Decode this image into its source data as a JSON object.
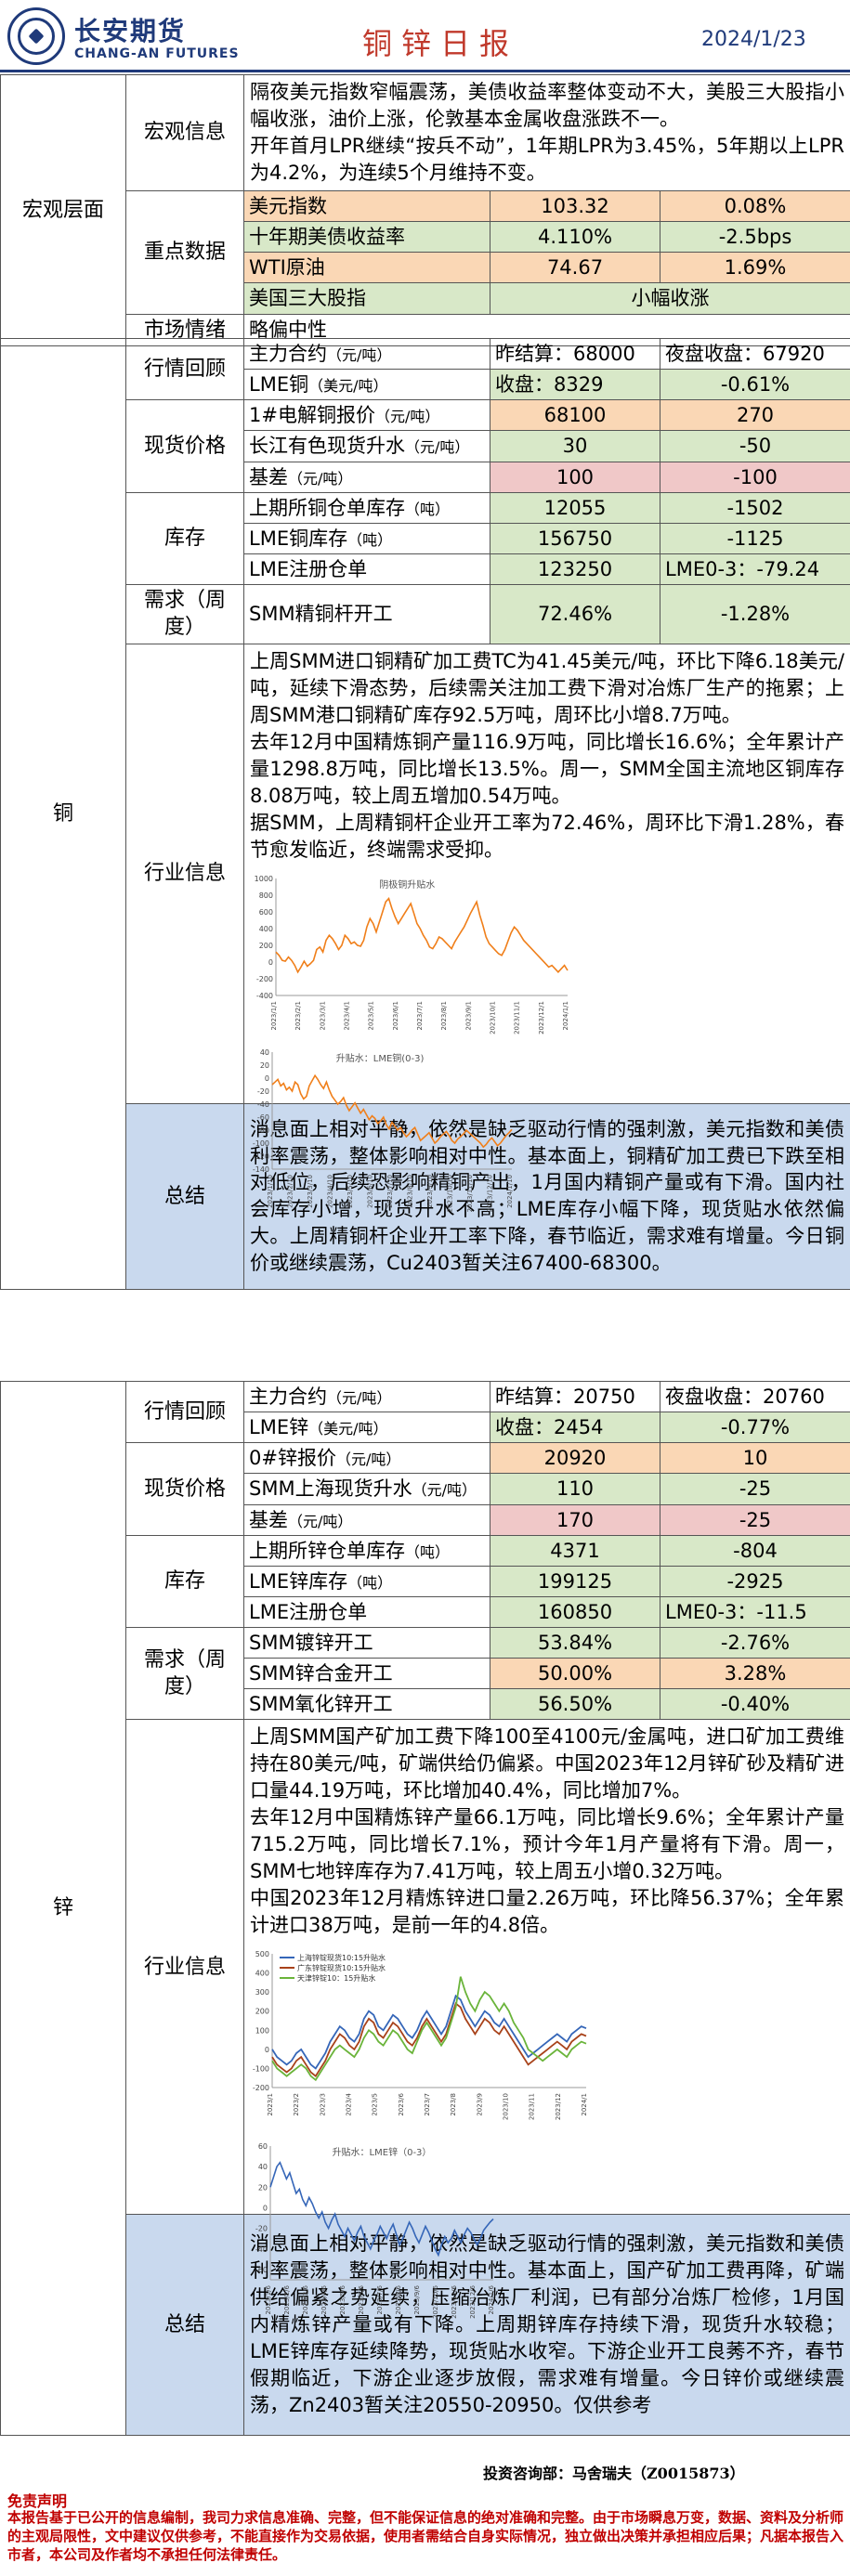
{
  "header": {
    "company_cn": "长安期货",
    "company_en": "CHANG-AN FUTURES",
    "title": "铜锌日报",
    "date": "2024/1/23"
  },
  "macro": {
    "section": "宏观层面",
    "info_label": "宏观信息",
    "info_text": "隔夜美元指数窄幅震荡，美债收益率整体变动不大，美股三大股指小幅收涨，油价上涨，伦敦基本金属收盘涨跌不一。\n开年首月LPR继续“按兵不动”，1年期LPR为3.45%，5年期以上LPR为4.2%，为连续5个月维持不变。",
    "data_label": "重点数据",
    "rows": [
      {
        "name": "美元指数",
        "val": "103.32",
        "chg": "0.08%"
      },
      {
        "name": "十年期美债收益率",
        "val": "4.110%",
        "chg": "-2.5bps"
      },
      {
        "name": "WTI原油",
        "val": "74.67",
        "chg": "1.69%"
      },
      {
        "name": "美国三大股指",
        "val": "小幅收涨"
      }
    ],
    "sentiment_label": "市场情绪",
    "sentiment": "略偏中性"
  },
  "copper": {
    "section": "铜",
    "review_label": "行情回顾",
    "main_contract": "主力合约",
    "main_unit": "（元/吨）",
    "prev_settle": "昨结算：68000",
    "night_close": "夜盘收盘：67920",
    "lme_name": "LME铜",
    "lme_unit": "（美元/吨）",
    "lme_close": "收盘：8329",
    "lme_chg": "-0.61%",
    "spot_label": "现货价格",
    "spot_rows": [
      {
        "name": "1#电解铜报价",
        "unit": "（元/吨）",
        "val": "68100",
        "chg": "270"
      },
      {
        "name": "长江有色现货升水",
        "unit": "（元/吨）",
        "val": "30",
        "chg": "-50"
      },
      {
        "name": "基差",
        "unit": "（元/吨）",
        "val": "100",
        "chg": "-100"
      }
    ],
    "stock_label": "库存",
    "stock_rows": [
      {
        "name": "上期所铜仓单库存",
        "unit": "（吨）",
        "val": "12055",
        "chg": "-1502"
      },
      {
        "name": "LME铜库存",
        "unit": "（吨）",
        "val": "156750",
        "chg": "-1125"
      },
      {
        "name": "LME注册仓单",
        "unit": "",
        "val": "123250",
        "chg": "LME0-3：-79.24"
      }
    ],
    "demand_label": "需求（周度）",
    "demand_rows": [
      {
        "name": "SMM精铜杆开工",
        "val": "72.46%",
        "chg": "-1.28%"
      }
    ],
    "industry_label": "行业信息",
    "industry_text": "上周SMM进口铜精矿加工费TC为41.45美元/吨，环比下降6.18美元/吨，延续下滑态势，后续需关注加工费下滑对冶炼厂生产的拖累；上周SMM港口铜精矿库存92.5万吨，周环比小增8.7万吨。\n去年12月中国精炼铜产量116.9万吨，同比增长16.6%；全年累计产量1298.8万吨，同比增长13.5%。周一，SMM全国主流地区铜库存8.08万吨，较上周五增加0.54万吨。\n据SMM，上周精铜杆企业开工率为72.46%，周环比下滑1.28%，春节愈发临近，终端需求受抑。",
    "summary_label": "总结",
    "summary_text": "消息面上相对平静，依然是缺乏驱动行情的强刺激，美元指数和美债利率震荡，整体影响相对中性。基本面上，铜精矿加工费已下跌至相对低位，后续恐影响精铜产出，1月国内精铜产量或有下滑。国内社会库存小增，现货升水不高；LME库存小幅下降，现货贴水依然偏大。上周精铜杆企业开工率下降，春节临近，需求难有增量。今日铜价或继续震荡，Cu2403暂关注67400-68300。"
  },
  "zinc": {
    "section": "锌",
    "review_label": "行情回顾",
    "main_contract": "主力合约",
    "main_unit": "（元/吨）",
    "prev_settle": "昨结算：20750",
    "night_close": "夜盘收盘：20760",
    "lme_name": "LME锌",
    "lme_unit": "（美元/吨）",
    "lme_close": "收盘：2454",
    "lme_chg": "-0.77%",
    "spot_label": "现货价格",
    "spot_rows": [
      {
        "name": "0#锌报价",
        "unit": "（元/吨）",
        "val": "20920",
        "chg": "10"
      },
      {
        "name": "SMM上海现货升水",
        "unit": "（元/吨）",
        "val": "110",
        "chg": "-25"
      },
      {
        "name": "基差",
        "unit": "（元/吨）",
        "val": "170",
        "chg": "-25"
      }
    ],
    "stock_label": "库存",
    "stock_rows": [
      {
        "name": "上期所锌仓单库存",
        "unit": "（吨）",
        "val": "4371",
        "chg": "-804"
      },
      {
        "name": "LME锌库存",
        "unit": "（吨）",
        "val": "199125",
        "chg": "-2925"
      },
      {
        "name": "LME注册仓单",
        "unit": "",
        "val": "160850",
        "chg": "LME0-3：-11.5"
      }
    ],
    "demand_label": "需求（周度）",
    "demand_rows": [
      {
        "name": "SMM镀锌开工",
        "val": "53.84%",
        "chg": "-2.76%"
      },
      {
        "name": "SMM锌合金开工",
        "val": "50.00%",
        "chg": "3.28%"
      },
      {
        "name": "SMM氧化锌开工",
        "val": "56.50%",
        "chg": "-0.40%"
      }
    ],
    "industry_label": "行业信息",
    "industry_text": "上周SMM国产矿加工费下降100至4100元/金属吨，进口矿加工费维持在80美元/吨，矿端供给仍偏紧。中国2023年12月锌矿砂及精矿进口量44.19万吨，环比增加40.4%，同比增加7%。\n去年12月中国精炼锌产量66.1万吨，同比增长9.6%；全年累计产量715.2万吨，同比增长7.1%，预计今年1月产量将有下滑。周一，SMM七地锌库存为7.41万吨，较上周五小增0.32万吨。\n中国2023年12月精炼锌进口量2.26万吨，环比降56.37%；全年累计进口38万吨，是前一年的4.8倍。",
    "summary_label": "总结",
    "summary_text": "消息面上相对平静，依然是缺乏驱动行情的强刺激，美元指数和美债利率震荡，整体影响相对中性。基本面上，国产矿加工费再降，矿端供给偏紧之势延续，压缩冶炼厂利润，已有部分冶炼厂检修，1月国内精炼锌产量或有下降。上周期锌库存持续下滑，现货升水较稳；LME锌库存延续降势，现货贴水收窄。下游企业开工良莠不齐，春节假期临近，下游企业逐步放假，需求难有增量。今日锌价或继续震荡，Zn2403暂关注20550-20950。仅供参考"
  },
  "chart_data": [
    {
      "type": "line",
      "title": "阴极铜升贴水",
      "color": "#f07f1a",
      "ylim": [
        -400,
        1000
      ],
      "yticks": [
        "1000",
        "800",
        "600",
        "400",
        "200",
        "0",
        "-200",
        "-400"
      ],
      "xticks": [
        "2023/1/1",
        "2023/2/1",
        "2023/3/1",
        "2023/4/1",
        "2023/5/1",
        "2023/6/1",
        "2023/7/1",
        "2023/8/1",
        "2023/9/1",
        "2023/10/1",
        "2023/11/1",
        "2023/12/1",
        "2024/1/1"
      ],
      "values": [
        120,
        80,
        20,
        10,
        60,
        20,
        -40,
        -120,
        -60,
        10,
        -50,
        -20,
        20,
        150,
        180,
        120,
        260,
        320,
        280,
        220,
        150,
        200,
        320,
        280,
        220,
        240,
        200,
        190,
        260,
        420,
        520,
        460,
        360,
        480,
        600,
        720,
        760,
        640,
        540,
        460,
        520,
        580,
        640,
        700,
        580,
        460,
        400,
        320,
        260,
        180,
        160,
        220,
        300,
        280,
        240,
        200,
        160,
        240,
        300,
        360,
        420,
        500,
        580,
        650,
        720,
        560,
        440,
        300,
        220,
        180,
        140,
        100,
        80,
        150,
        250,
        350,
        420,
        380,
        320,
        260,
        220,
        180,
        140,
        100,
        60,
        20,
        -20,
        -60,
        -40,
        -80,
        -120,
        -80,
        -40,
        -100
      ]
    },
    {
      "type": "line",
      "title": "升贴水：LME铜(0-3)",
      "color": "#f07f1a",
      "ylim": [
        -140,
        40
      ],
      "yticks": [
        "40",
        "20",
        "0",
        "-20",
        "-40",
        "-60",
        "-80",
        "-100",
        "-120",
        "-140"
      ],
      "xticks": [
        "2023/1/10",
        "2023/2/10",
        "2023/3/10",
        "2023/4/10",
        "2023/5/10",
        "2023/6/10",
        "2023/7/10",
        "2023/8/10",
        "2023/9/10",
        "2023/10/10",
        "2023/11/10",
        "2023/12/10",
        "2024/1/10"
      ],
      "values": [
        -10,
        -6,
        -2,
        -12,
        -8,
        -18,
        -14,
        -20,
        -6,
        -10,
        -24,
        -32,
        -28,
        -12,
        -4,
        4,
        -2,
        -10,
        -16,
        -6,
        -18,
        -28,
        -34,
        -40,
        -36,
        -30,
        -42,
        -50,
        -44,
        -38,
        -46,
        -54,
        -48,
        -56,
        -64,
        -58,
        -62,
        -70,
        -66,
        -60,
        -72,
        -78,
        -68,
        -74,
        -80,
        -76,
        -84,
        -90,
        -86,
        -80,
        -76,
        -86,
        -96,
        -92,
        -88,
        -84,
        -92,
        -100,
        -96,
        -90,
        -86,
        -82,
        -88,
        -96,
        -100,
        -94,
        -90,
        -86,
        -80,
        -84,
        -88,
        -92,
        -96,
        -100,
        -106,
        -102,
        -96,
        -92,
        -98,
        -104,
        -100,
        -94,
        -88,
        -84,
        -79
      ]
    },
    {
      "type": "line",
      "title": "",
      "ylim": [
        -200,
        500
      ],
      "yticks": [
        "500",
        "400",
        "300",
        "200",
        "100",
        "0",
        "-100",
        "-200"
      ],
      "xticks": [
        "2023/1",
        "2023/2",
        "2023/3",
        "2023/4",
        "2023/5",
        "2023/6",
        "2023/7",
        "2023/8",
        "2023/9",
        "2023/10",
        "2023/11",
        "2023/12",
        "2024/1"
      ],
      "series": [
        {
          "name": "上海锌锭现货10:15升贴水",
          "color": "#3566b8",
          "values": [
            0,
            -40,
            -60,
            -80,
            -60,
            -20,
            0,
            -40,
            -80,
            -100,
            -60,
            -20,
            40,
            80,
            120,
            100,
            60,
            40,
            80,
            160,
            200,
            180,
            120,
            100,
            140,
            180,
            160,
            120,
            80,
            60,
            100,
            160,
            200,
            160,
            120,
            80,
            120,
            200,
            280,
            260,
            200,
            160,
            120,
            160,
            200,
            180,
            140,
            120,
            160,
            120,
            80,
            40,
            0,
            -40,
            -20,
            0,
            20,
            40,
            60,
            80,
            60,
            40,
            80,
            100,
            120,
            110
          ]
        },
        {
          "name": "广东锌锭现货10:15升贴水",
          "color": "#a8421a",
          "values": [
            -40,
            -80,
            -100,
            -120,
            -100,
            -60,
            -40,
            -80,
            -120,
            -140,
            -100,
            -60,
            0,
            40,
            80,
            60,
            20,
            0,
            40,
            120,
            160,
            140,
            80,
            60,
            100,
            140,
            120,
            80,
            40,
            20,
            60,
            120,
            160,
            120,
            80,
            40,
            80,
            160,
            240,
            220,
            160,
            120,
            80,
            120,
            160,
            140,
            100,
            80,
            120,
            80,
            40,
            0,
            -40,
            -80,
            -60,
            -40,
            -20,
            0,
            20,
            40,
            20,
            0,
            40,
            60,
            80,
            70
          ]
        },
        {
          "name": "天津锌锭10：15升贴水",
          "color": "#6ab43a",
          "values": [
            -60,
            -100,
            -120,
            -140,
            -120,
            -100,
            -80,
            -100,
            -140,
            -160,
            -120,
            -80,
            -40,
            0,
            20,
            0,
            -20,
            -40,
            0,
            60,
            100,
            80,
            40,
            20,
            60,
            100,
            80,
            40,
            0,
            -20,
            40,
            100,
            140,
            100,
            60,
            20,
            60,
            140,
            220,
            380,
            300,
            240,
            200,
            260,
            300,
            280,
            240,
            200,
            240,
            200,
            140,
            100,
            60,
            0,
            -20,
            -40,
            -60,
            -40,
            -20,
            0,
            -20,
            -40,
            0,
            20,
            40,
            30
          ]
        }
      ]
    },
    {
      "type": "line",
      "title": "升贴水：LME锌（0-3）",
      "color": "#3566b8",
      "ylim": [
        -70,
        60
      ],
      "yticks": [
        "60",
        "40",
        "20",
        "0",
        "-20",
        "-40",
        "-60"
      ],
      "xticks": [
        "2023/1/6",
        "2023/2/6",
        "2023/3/6",
        "2023/4/6",
        "2023/5/6",
        "2023/6/6",
        "2023/7/6",
        "2023/8/6",
        "2023/9/6",
        "2023/10/6",
        "2023/11/6",
        "2023/12/6",
        "2024/1/6"
      ],
      "values": [
        20,
        30,
        40,
        44,
        36,
        28,
        34,
        24,
        14,
        18,
        8,
        2,
        10,
        4,
        -4,
        -10,
        -4,
        -14,
        -20,
        -12,
        -6,
        -16,
        -22,
        -28,
        -20,
        -26,
        -32,
        -24,
        -18,
        -28,
        -34,
        -40,
        -32,
        -26,
        -18,
        -24,
        -30,
        -22,
        -16,
        -26,
        -36,
        -30,
        -22,
        -14,
        -20,
        -28,
        -34,
        -26,
        -18,
        -24,
        -32,
        -40,
        -46,
        -36,
        -28,
        -34,
        -30,
        -22,
        -28,
        -34,
        -26,
        -20,
        -24,
        -30,
        -36,
        -30,
        -22,
        -18,
        -14,
        -11
      ]
    }
  ],
  "footer": {
    "contact": "投资咨询部：马舍瑞夫（Z0015873）",
    "disclaimer_title": "免责声明",
    "disclaimer": "本报告基于已公开的信息编制，我司力求信息准确、完整，但不能保证信息的绝对准确和完整。由于市场瞬息万变，数据、资料及分析师的主观局限性，文中建议仅供参考，不能直接作为交易依据，使用者需结合自身实际情况，独立做出决策并承担相应后果；凡据本报告入市者，本公司及作者均不承担任何法律责任。"
  }
}
